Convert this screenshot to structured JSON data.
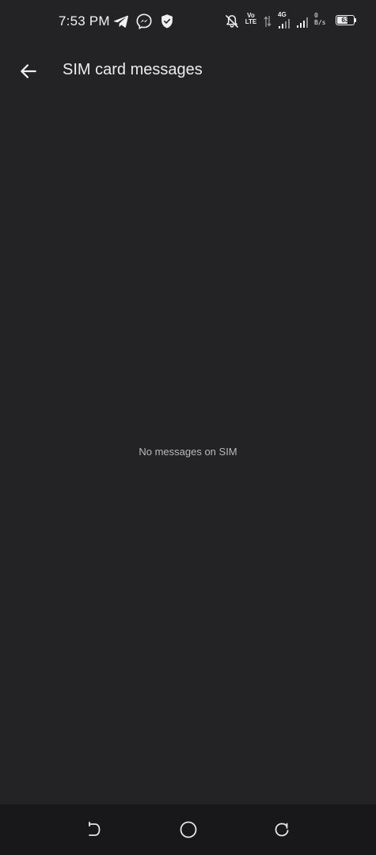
{
  "status_bar": {
    "time": "7:53 PM",
    "volte_top": "Vo",
    "volte_bottom": "LTE",
    "network_type": "4G",
    "speed_value": "0",
    "speed_unit": "B/s",
    "battery_level": "63",
    "battery_fraction": 0.63,
    "icons": [
      "telegram-icon",
      "messenger-icon",
      "shield-icon",
      "bell-off-icon",
      "signal-icon"
    ]
  },
  "app_bar": {
    "title": "SIM card messages",
    "back_icon": "arrow-left-icon"
  },
  "content": {
    "empty_message": "No messages on SIM"
  },
  "nav_bar": {
    "buttons": [
      "back-nav-icon",
      "home-nav-icon",
      "recents-nav-icon"
    ]
  },
  "colors": {
    "background": "#232325",
    "nav_background": "#18181a",
    "text_primary": "#ececee",
    "text_secondary": "#b9b9bd"
  }
}
